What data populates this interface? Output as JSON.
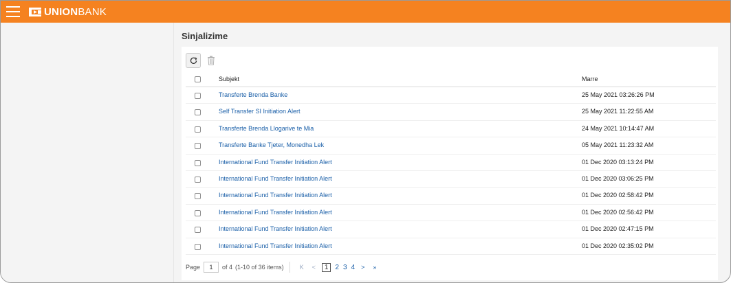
{
  "header": {
    "logo_bold": "UNION",
    "logo_light": "BANK",
    "bar_color": "#f58220"
  },
  "page": {
    "title": "Sinjalizime"
  },
  "toolbar": {
    "refresh_icon": "refresh-icon",
    "delete_icon": "trash-icon"
  },
  "table": {
    "columns": {
      "subject": "Subjekt",
      "received": "Marre"
    },
    "rows": [
      {
        "subject": "Transferte Brenda Banke",
        "date": "25 May 2021 03:26:26 PM"
      },
      {
        "subject": "Self Transfer SI Initiation Alert",
        "date": "25 May 2021 11:22:55 AM"
      },
      {
        "subject": "Transferte Brenda Llogarive te Mia",
        "date": "24 May 2021 10:14:47 AM"
      },
      {
        "subject": "Transferte Banke Tjeter, Monedha Lek",
        "date": "05 May 2021 11:23:32 AM"
      },
      {
        "subject": "International Fund Transfer Initiation Alert",
        "date": "01 Dec 2020 03:13:24 PM"
      },
      {
        "subject": "International Fund Transfer Initiation Alert",
        "date": "01 Dec 2020 03:06:25 PM"
      },
      {
        "subject": "International Fund Transfer Initiation Alert",
        "date": "01 Dec 2020 02:58:42 PM"
      },
      {
        "subject": "International Fund Transfer Initiation Alert",
        "date": "01 Dec 2020 02:56:42 PM"
      },
      {
        "subject": "International Fund Transfer Initiation Alert",
        "date": "01 Dec 2020 02:47:15 PM"
      },
      {
        "subject": "International Fund Transfer Initiation Alert",
        "date": "01 Dec 2020 02:35:02 PM"
      }
    ]
  },
  "pager": {
    "page_label": "Page",
    "page_value": "1",
    "of_label": "of 4",
    "items_label": "(1-10 of 36 items)",
    "first": "K",
    "prev": "<",
    "pages": [
      "1",
      "2",
      "3",
      "4"
    ],
    "next": ">",
    "last": "»"
  }
}
